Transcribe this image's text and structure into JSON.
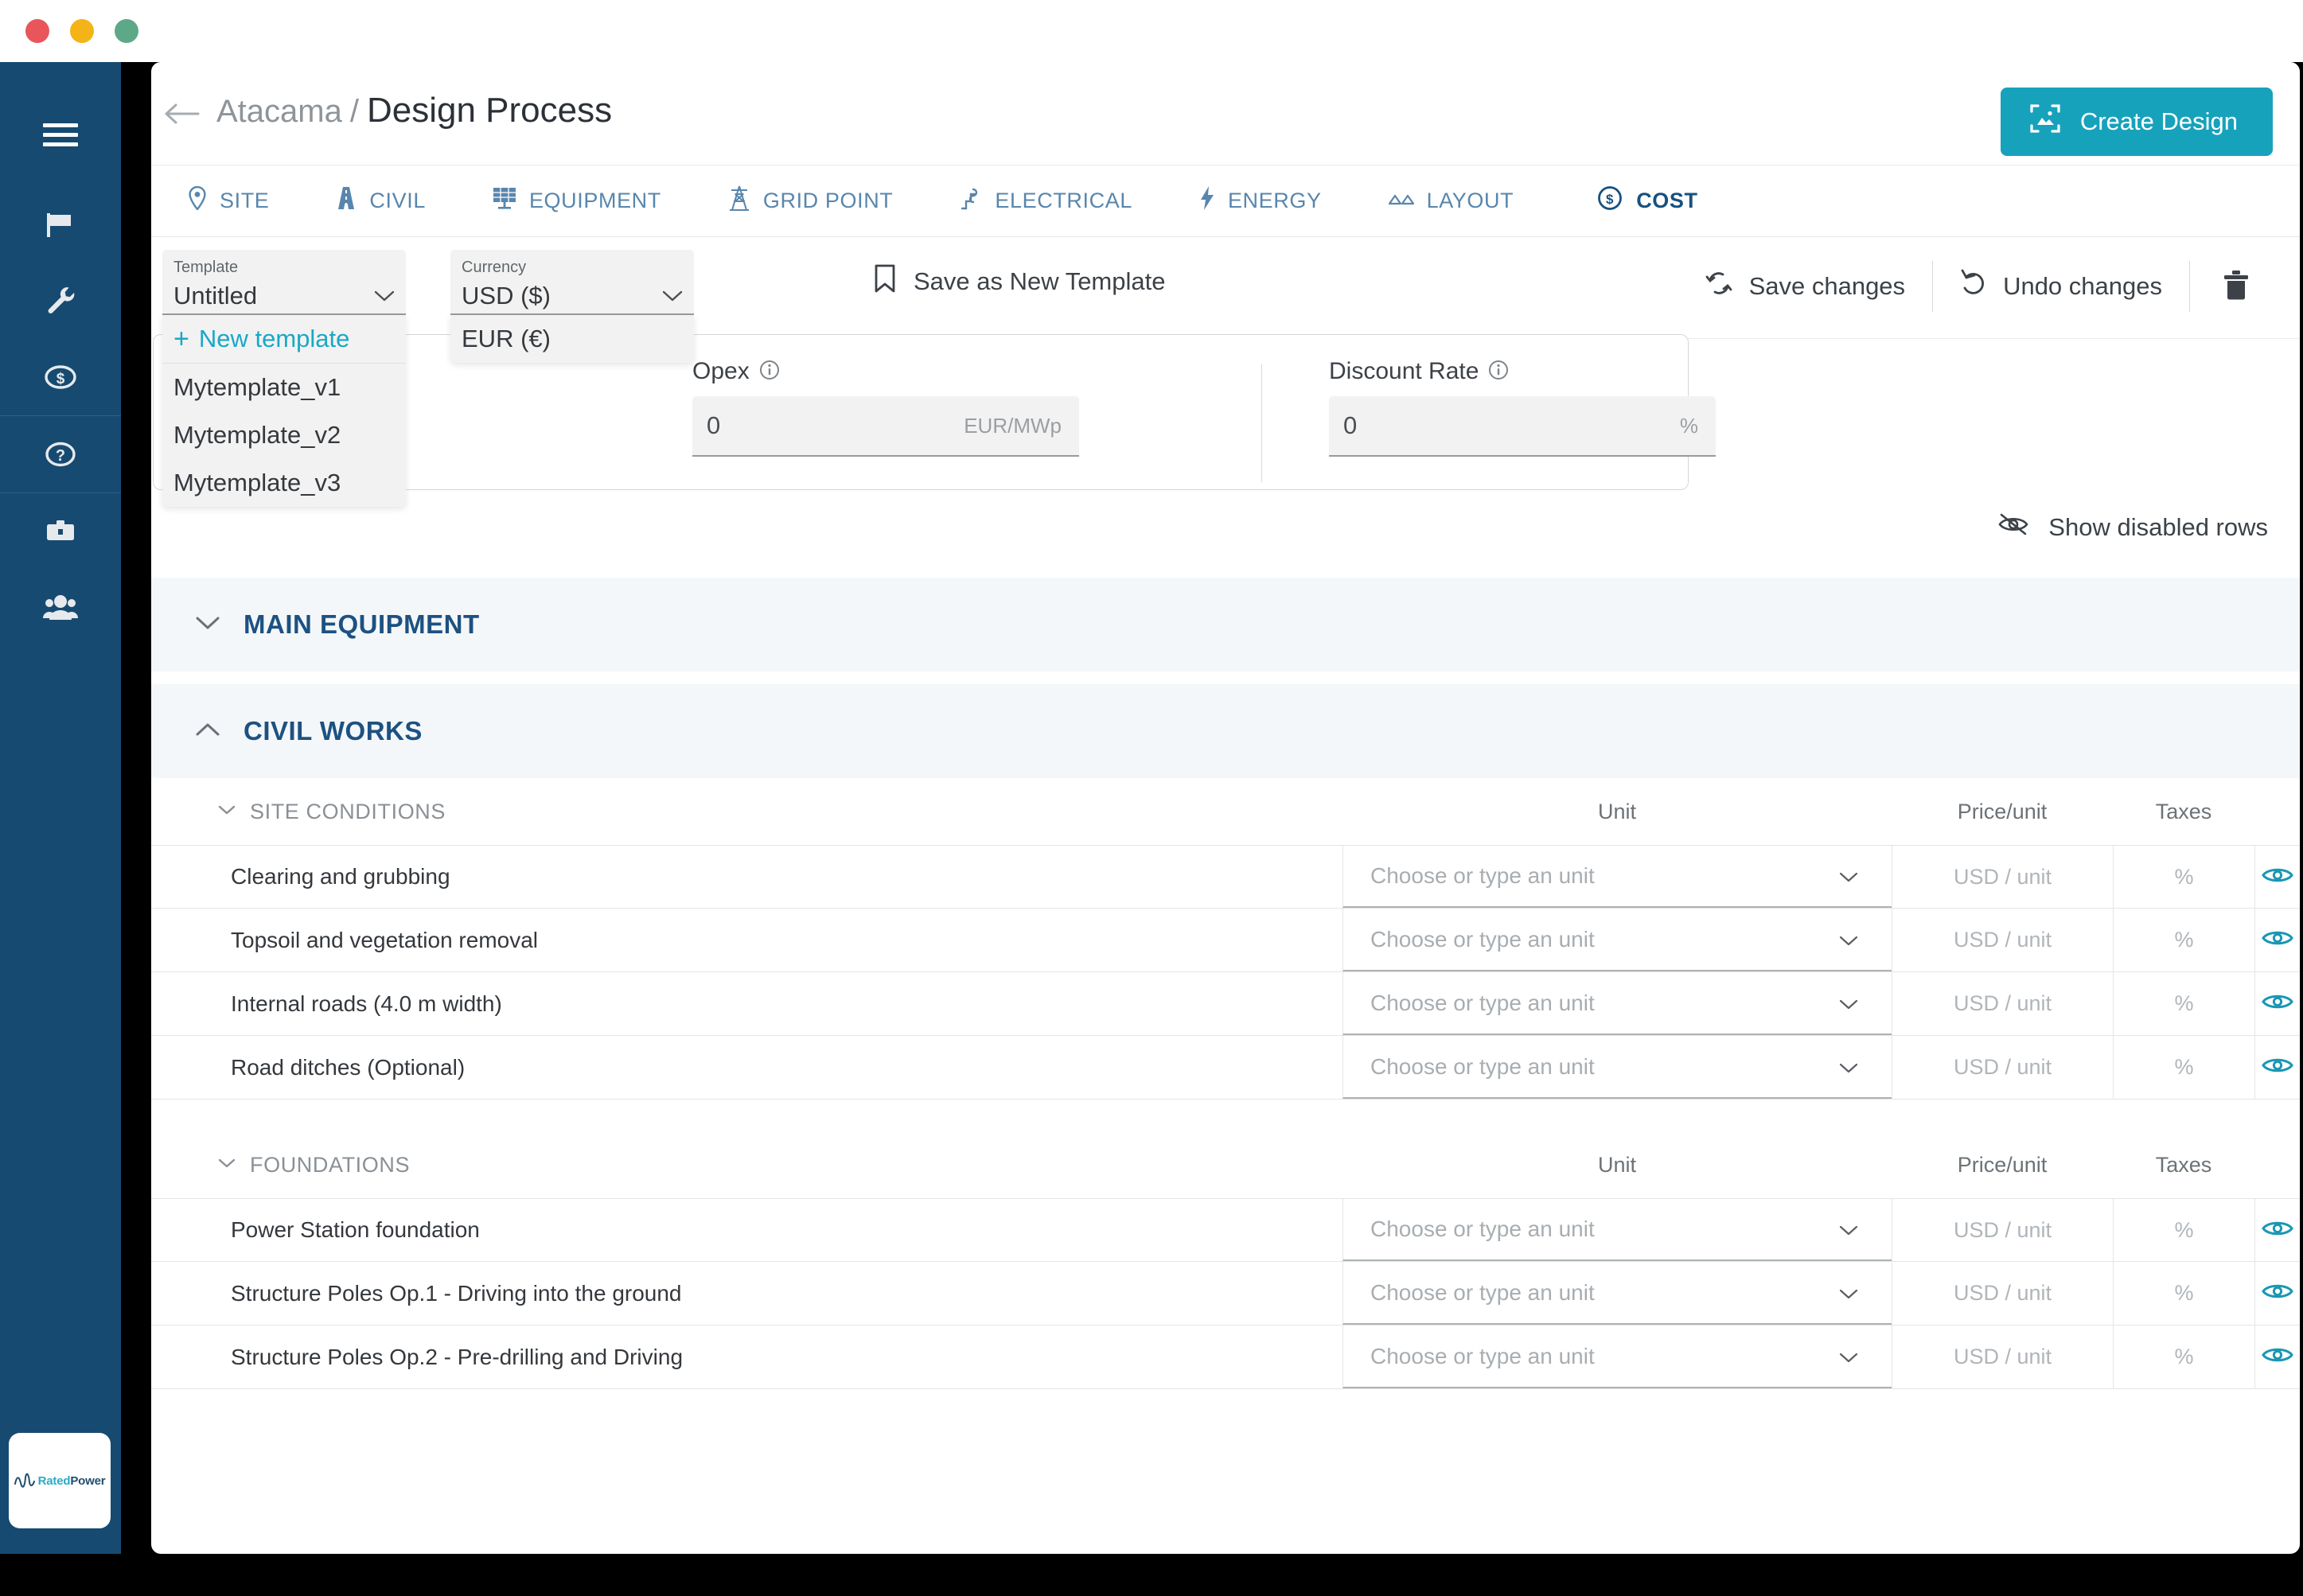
{
  "window": {
    "buttons": [
      "close",
      "minimize",
      "zoom"
    ]
  },
  "sidebar": {
    "items": [
      {
        "name": "menu",
        "icon": "hamburger-icon"
      },
      {
        "name": "projects",
        "icon": "flag-icon"
      },
      {
        "name": "tools",
        "icon": "wrench-icon"
      },
      {
        "name": "costs",
        "icon": "dollar-coin-icon"
      },
      {
        "name": "help",
        "icon": "question-circle-icon"
      },
      {
        "name": "portfolio",
        "icon": "briefcase-icon"
      },
      {
        "name": "team",
        "icon": "users-icon"
      }
    ],
    "logo": {
      "part1": "Rated",
      "part2": "Power"
    }
  },
  "header": {
    "back_icon": "arrow-left-icon",
    "breadcrumb_project": "Atacama",
    "breadcrumb_separator": "/",
    "breadcrumb_title": "Design Process",
    "create_design_label": "Create Design",
    "create_design_icon": "image-frame-icon",
    "accent_color": "#17A2BC"
  },
  "tabs": [
    {
      "label": "SITE",
      "icon": "map-pin-icon",
      "active": false
    },
    {
      "label": "CIVIL",
      "icon": "road-icon",
      "active": false
    },
    {
      "label": "EQUIPMENT",
      "icon": "solar-panel-icon",
      "active": false
    },
    {
      "label": "GRID POINT",
      "icon": "pylon-icon",
      "active": false
    },
    {
      "label": "ELECTRICAL",
      "icon": "circuit-icon",
      "active": false
    },
    {
      "label": "ENERGY",
      "icon": "bolt-icon",
      "active": false
    },
    {
      "label": "LAYOUT",
      "icon": "layout-icon",
      "active": false
    },
    {
      "label": "COST",
      "icon": "dollar-coin-icon",
      "active": true
    }
  ],
  "toolbar": {
    "template": {
      "label": "Template",
      "value": "Untitled",
      "open": true,
      "new_option": "New template",
      "options": [
        "Mytemplate_v1",
        "Mytemplate_v2",
        "Mytemplate_v3"
      ]
    },
    "currency": {
      "label": "Currency",
      "value": "USD ($)",
      "open": true,
      "options": [
        "EUR (€)"
      ]
    },
    "save_as_new_template": "Save as New Template",
    "save_changes": "Save changes",
    "undo_changes": "Undo changes",
    "delete_icon": "trash-icon",
    "save_template_icon": "bookmark-icon",
    "save_changes_icon": "sync-icon",
    "undo_changes_icon": "undo-icon"
  },
  "summary": {
    "opex": {
      "label": "Opex",
      "info_icon": "info-icon",
      "value": "0",
      "unit": "EUR/MWp"
    },
    "discount_rate": {
      "label": "Discount Rate",
      "info_icon": "info-icon",
      "value": "0",
      "unit": "%"
    }
  },
  "show_disabled_rows": {
    "label": "Show disabled rows",
    "icon": "eye-off-icon"
  },
  "sections": [
    {
      "title": "MAIN EQUIPMENT",
      "expanded": false,
      "chevron": "chevron-down-icon",
      "subsections": []
    },
    {
      "title": "CIVIL WORKS",
      "expanded": true,
      "chevron": "chevron-up-icon",
      "subsections": [
        {
          "title": "SITE CONDITIONS",
          "chevron": "chevron-down-icon",
          "columns": [
            "Unit",
            "Price/unit",
            "Taxes"
          ],
          "rows": [
            {
              "name": "Clearing and grubbing",
              "unit_placeholder": "Choose or type an unit",
              "price_placeholder": "USD / unit",
              "taxes_placeholder": "%",
              "visibility_icon": "eye-icon"
            },
            {
              "name": "Topsoil and vegetation removal",
              "unit_placeholder": "Choose or type an unit",
              "price_placeholder": "USD / unit",
              "taxes_placeholder": "%",
              "visibility_icon": "eye-icon"
            },
            {
              "name": "Internal roads (4.0 m width)",
              "unit_placeholder": "Choose or type an unit",
              "price_placeholder": "USD / unit",
              "taxes_placeholder": "%",
              "visibility_icon": "eye-icon"
            },
            {
              "name": "Road ditches (Optional)",
              "unit_placeholder": "Choose or type an unit",
              "price_placeholder": "USD / unit",
              "taxes_placeholder": "%",
              "visibility_icon": "eye-icon"
            }
          ]
        },
        {
          "title": "FOUNDATIONS",
          "chevron": "chevron-down-icon",
          "columns": [
            "Unit",
            "Price/unit",
            "Taxes"
          ],
          "rows": [
            {
              "name": "Power Station foundation",
              "unit_placeholder": "Choose or type an unit",
              "price_placeholder": "USD / unit",
              "taxes_placeholder": "%",
              "visibility_icon": "eye-icon"
            },
            {
              "name": "Structure Poles Op.1 - Driving into the ground",
              "unit_placeholder": "Choose or type an unit",
              "price_placeholder": "USD / unit",
              "taxes_placeholder": "%",
              "visibility_icon": "eye-icon"
            },
            {
              "name": "Structure Poles Op.2 - Pre-drilling and Driving",
              "unit_placeholder": "Choose or type an unit",
              "price_placeholder": "USD / unit",
              "taxes_placeholder": "%",
              "visibility_icon": "eye-icon"
            }
          ]
        }
      ]
    }
  ],
  "colors": {
    "sidebar_bg": "#174A71",
    "accent_teal": "#17A2BC",
    "section_blue": "#1D5181",
    "tab_blue": "#5886AD",
    "section_bg": "#F4F7F9"
  }
}
